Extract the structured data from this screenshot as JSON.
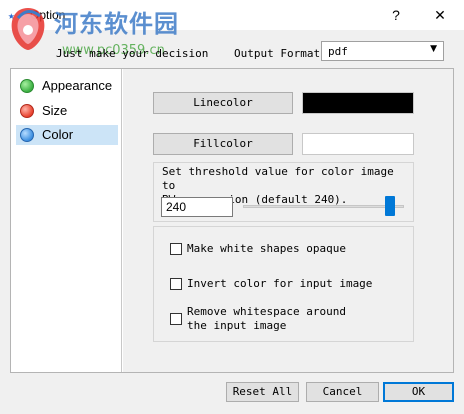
{
  "window": {
    "title": "Option",
    "help_glyph": "?",
    "close_glyph": "✕",
    "app_icon": "app-icon"
  },
  "watermark": {
    "text": "河东软件园",
    "url": "www.pc0359.cn"
  },
  "header": {
    "subtitle": "Just make your decision",
    "output_format_label": "Output Format:",
    "output_format_value": "pdf",
    "dropdown_icon": "▼"
  },
  "nav": {
    "items": [
      {
        "label": "Appearance",
        "color": "#3cb043"
      },
      {
        "label": "Size",
        "color": "#e8412e"
      },
      {
        "label": "Color",
        "color": "#3d8fe0",
        "selected": true
      }
    ]
  },
  "color_page": {
    "linecolor_label": "Linecolor",
    "linecolor_value": "#000000",
    "fillcolor_label": "Fillcolor",
    "fillcolor_value": "#ffffff",
    "threshold_text_1": "Set threshold value for color image to",
    "threshold_text_2": "BW conversion (default 240).",
    "threshold_value": "240",
    "threshold_slider_level": 0.94,
    "checkboxes": [
      {
        "label": "Make white shapes opaque",
        "checked": false
      },
      {
        "label": "Invert color for input image",
        "checked": false
      },
      {
        "label_1": "Remove whitespace around",
        "label_2": "the input image",
        "checked": false
      }
    ]
  },
  "footer": {
    "reset_label": "Reset All",
    "cancel_label": "Cancel",
    "ok_label": "OK"
  },
  "colors": {
    "accent": "#0078d7",
    "selection": "#cce4f7"
  }
}
